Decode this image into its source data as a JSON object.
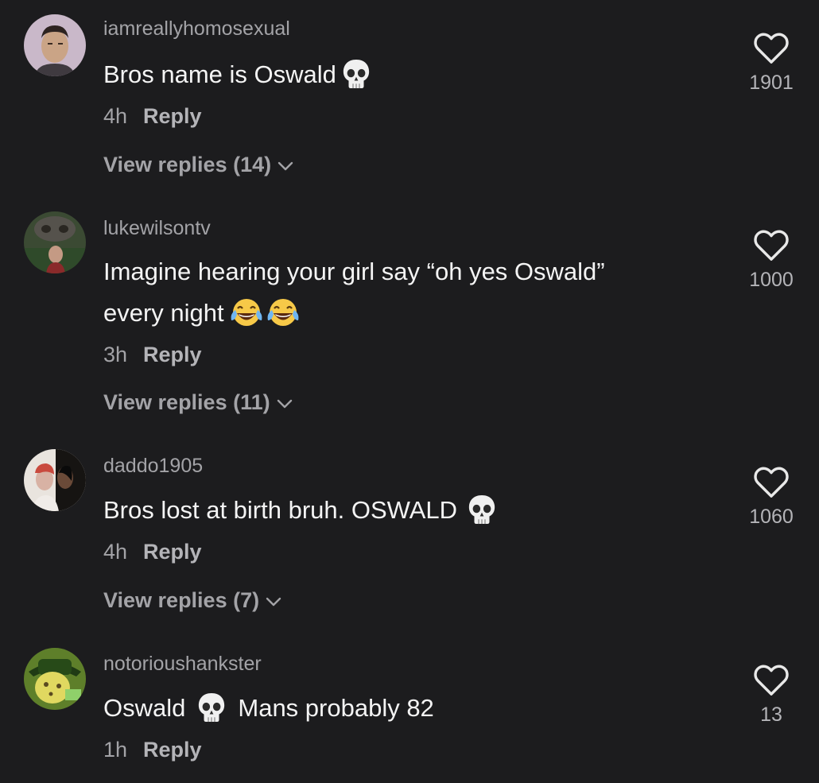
{
  "comments": [
    {
      "username": "iamreallyhomosexual",
      "text": "Bros name is Oswald",
      "text_after_emoji": "",
      "emoji": "skull-emoji",
      "time": "4h",
      "reply_label": "Reply",
      "view_replies_label": "View replies (14)",
      "likes": "1901"
    },
    {
      "username": "lukewilsontv",
      "text_line1": "Imagine hearing your girl say “oh yes Oswald”",
      "text_line2": "every night",
      "emoji": "tears-of-joy-emoji",
      "time": "3h",
      "reply_label": "Reply",
      "view_replies_label": "View replies (11)",
      "likes": "1000"
    },
    {
      "username": "daddo1905",
      "text": "Bros lost at birth bruh. OSWALD",
      "emoji": "skull-emoji",
      "time": "4h",
      "reply_label": "Reply",
      "view_replies_label": "View replies (7)",
      "likes": "1060"
    },
    {
      "username": "notorioushankster",
      "text": "Oswald",
      "text_after_emoji": "Mans probably 82",
      "emoji": "skull-emoji",
      "time": "1h",
      "reply_label": "Reply",
      "likes": "13"
    }
  ],
  "icons": {
    "heart": "heart-outline-icon",
    "chevron": "chevron-down-icon",
    "skull": "skull-emoji",
    "laugh": "tears-of-joy-emoji"
  },
  "colors": {
    "background": "#1c1c1e",
    "username": "#a3a3a7",
    "text": "#f4f4f4",
    "secondary": "#b4b4b8"
  }
}
